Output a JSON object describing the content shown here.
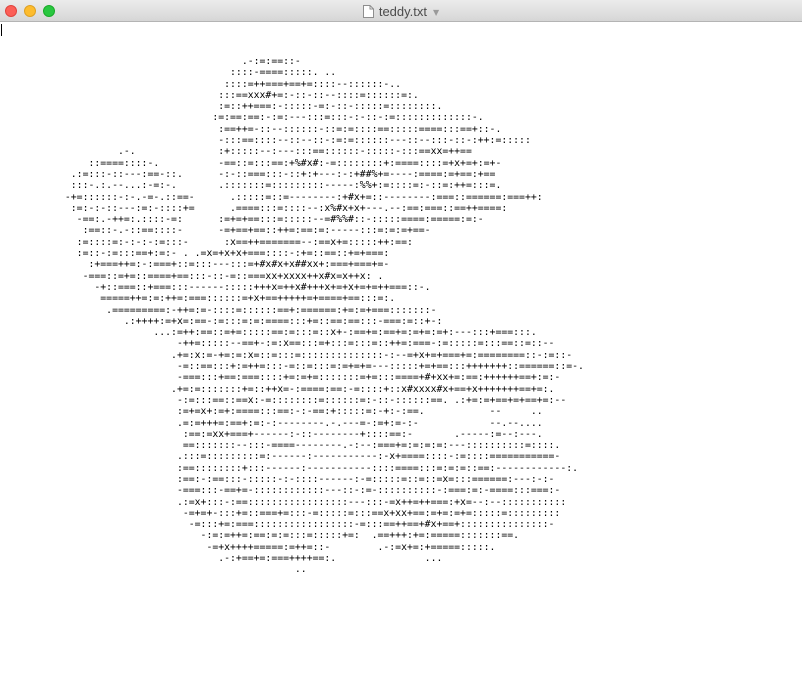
{
  "window": {
    "title": "teddy.txt",
    "controls": [
      "close-button",
      "minimize-button",
      "zoom-button"
    ],
    "icons": {
      "document": "document-icon",
      "title_menu": "chevron-down-icon"
    }
  },
  "document": {
    "ascii_art": "                                         .-:=:==::-\n                                       ::::-====:::::. ..\n                                      ::::=++===+==+=::::--::::::-..\n                                     :::==xxx#+=:-::-::--::::=::::::=:.\n                                     :=::++===:-:::::-=:-::-:::::=::::::::.\n                                    :=:==:==:-:=:---:::=:::-:-::-:=:::::::::::::-.\n                                     :==++=-::--::::::-::=:=::::==:::::====:::==+::-.\n                                     -:::==::::--::--::-:=:=::::::---::--:::-::-:++:=:::::\n                    .-.              :+:::::--:---:::==::::::-:::::-:::==xx=++==\n               ::====::::-.          -==::=:::==:+%#x#:-=::::::::+:====::::=+x+=+:=+-\n            .:=:::-::---:==-::.      -:-::===:::-::+:+---:-:+##%+=----:====:=+==:+==\n            :::-.:.--...:-=:-.       .:::::::=:::::::::-----:%%+:=::::=:-::=:++=:::=.\n           -+=::::::-:-.-=-.::==-      .:::::=::=--------:+#x+=::--------:===::======:===++:\n            :=:-:-::---:=:-::::+=      .====:::=::::--:x%#x+x+---.--:==:===::==++====:\n             -==:.-++=:.::::-=:      :=+=+==:::=:::::--=#%%#::-:::::====:=====:=:-\n              :==::-.-::==::::-      -=+==+==::++=:==:=:-----:::=:=:=+==-\n             :=::::=:-:-:-:=:::-      :x==++=======--:==x+=:::::++:==:\n             :=::-:=:::==+:=:- . .=x=+x+x+===::::-:+=::==::+=+===:\n               :+===++=:-:===+::=:::---:::=+#x#x+x##xx+:===+===+=-\n              -===::=+=::====+==:::-::-=::===xx+xxxx++x#x=x++x: .\n                -+::===::+===:::------:::::+++x=++x#+++x+=+x+=+=++===::-.\n                 =====++=:=:++=:===::::::=+x+==+++++=+====+==:::=:.\n                  .=========:-++=:=-::::=::::::==+:======:+=:=+===:::::::-\n                     .:++++:=+x=:==-:=:::=:=:====:::+=::==:==:::-===:=::+-:\n                          ...:=++:==::=+=:::::==:=:::=::x+-:==+=:==+=:=+=:=+:---:::+===:::.\n                              -++=:::::--==+-:=:x==:::=+:::=:::=::++=:===-:=:::::=:::==::=::--\n                             .+=:x:=-+=:=:x=::=:::=::::::::::::::-:--=+x+=+===+=:========::-:=::-\n                              -=::==:::+:=++=:::-=::=:::=:=+=+=---:::::+=+==:::+++++++::======::=-.\n                              -===:::+==:===::::+=:=+=:::::::=+=:::====+#+xx+=:==:++++++==+:=:-\n                             .+=:=:::::::+=::++x=-:====:==:-=::::+::x#xxxx#x+==+x+++++++==+=:.\n                              -:=:::==::==x:-=::::::::=::::::=:-::-::::::==. .:+=:=+==+=+==+=:--\n                              :=+=x+:=+:====:::==:-:-==:+:::::=:-+:-:==.           --     ..\n                              .=:=+++=:==+:=:-:--------.-.---=-:=+:=-:-            --.--....\n                               :==:=xx+===+------:-::--------+::::==:-       .-----:=--:---.\n                               ==:::::::--:::-====--------.-:--:===+=:=:=:=:---::::::::::=::::.\n                              .:::=:::::::::=:------:-----------:-x+====::::-:=::::===========-\n                              :==::::::::+:::------:-----------::::====:::=:=:=::==:------------:.\n                              :==:-:==:::-:::::-:-::::------:-=:::::=::=::=x=:::======:---:-:-\n                              -===:::-==+=-::::::::::::---::-:=-::::::::::-:===:=:-====:::===:-\n                              .:=x+:::-:==:::::::::::::::::---:::-=x++=++===:+x=--:--:::::::::::\n                               -=+=+-:::+=::===+=:::-=:::::=:::==x+xx+==:=+=:=+=:::::=:::::::::\n                                -=:::+=:===:::::::::::::::::-=:::==++==+#x+==+:::::::::::::::-\n                                  -:=:=++=:==:=:=:::=:::::+=:  .==+++:+=:=====:::::::==.\n                                   -=+x++++=====:=++=::-        .-:=x+=:+=====:::::.\n                                     .-:+==+=:===++++==:.               ...\n                                                  .."
  }
}
